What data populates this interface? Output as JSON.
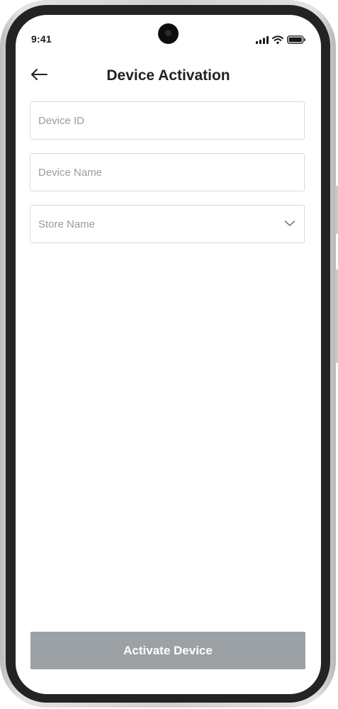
{
  "status_bar": {
    "time": "9:41",
    "icons": [
      "cellular-signal-icon",
      "wifi-icon",
      "battery-icon"
    ]
  },
  "header": {
    "back_icon": "arrow-left-icon",
    "title": "Device Activation"
  },
  "form": {
    "device_id": {
      "value": "",
      "placeholder": "Device ID"
    },
    "device_name": {
      "value": "",
      "placeholder": "Device Name"
    },
    "store_name": {
      "selected": "Store Name",
      "icon": "chevron-down-icon"
    }
  },
  "actions": {
    "activate_label": "Activate Device",
    "activate_color": "#9ca1a6"
  },
  "colors": {
    "text": "#222222",
    "placeholder": "#9c9c9c",
    "field_border": "#d9d9d9",
    "bezel": "#232325"
  }
}
